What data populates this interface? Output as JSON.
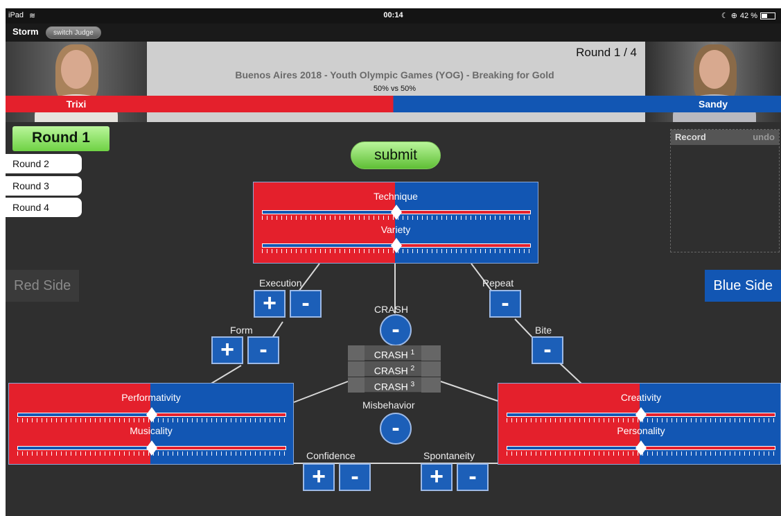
{
  "status_bar": {
    "device": "iPad",
    "time": "00:14",
    "battery": "42 %",
    "battery_level": 0.42
  },
  "topbar": {
    "app_name": "Storm",
    "switch_label": "switch Judge"
  },
  "header": {
    "round_info": "Round 1 / 4",
    "event_title": "Buenos Aires 2018 - Youth Olympic Games (YOG) - Breaking for Gold",
    "score_text": "50% vs 50%",
    "red_share": 0.5,
    "left_name": "Trixi",
    "right_name": "Sandy"
  },
  "rounds": {
    "active": "Round 1",
    "tabs": [
      "Round 2",
      "Round 3",
      "Round 4"
    ]
  },
  "submit_label": "submit",
  "record": {
    "title": "Record",
    "undo": "undo"
  },
  "sides": {
    "red": "Red Side",
    "blue": "Blue Side"
  },
  "sliders": {
    "technique": {
      "label": "Technique",
      "value": 0.5
    },
    "variety": {
      "label": "Variety",
      "value": 0.5
    },
    "performativity": {
      "label": "Performativity",
      "value": 0.5
    },
    "musicality": {
      "label": "Musicality",
      "value": 0.5
    },
    "creativity": {
      "label": "Creativity",
      "value": 0.5
    },
    "personality": {
      "label": "Personality",
      "value": 0.5
    }
  },
  "labels": {
    "execution": "Execution",
    "form": "Form",
    "repeat": "Repeat",
    "bite": "Bite",
    "crash": "CRASH",
    "misbehavior": "Misbehavior",
    "confidence": "Confidence",
    "spontaneity": "Spontaneity"
  },
  "crash_rows": [
    {
      "label": "CRASH",
      "num": "1"
    },
    {
      "label": "CRASH",
      "num": "2"
    },
    {
      "label": "CRASH",
      "num": "3"
    }
  ],
  "buttons": {
    "plus": "+",
    "minus": "-"
  },
  "colors": {
    "red": "#e4202c",
    "blue": "#1256b3",
    "green": "#6fd244"
  }
}
